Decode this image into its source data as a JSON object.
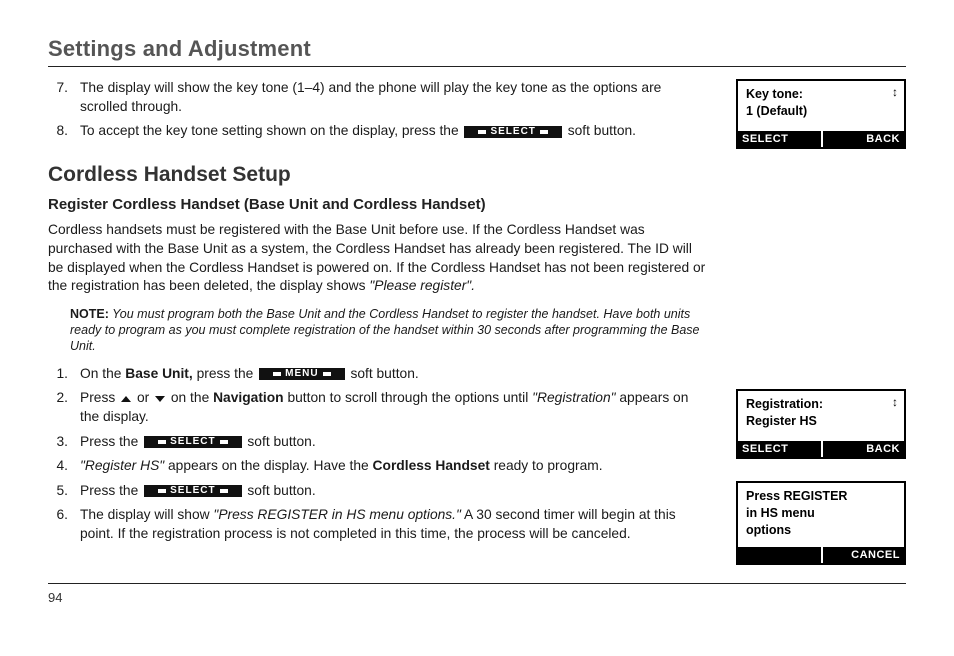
{
  "section_title": "Settings and Adjustment",
  "steps_top": [
    {
      "n": "7.",
      "pre": "The display will show the key tone (1–4) and the phone will play the key tone as the options are scrolled through."
    },
    {
      "n": "8.",
      "pre": "To accept the key tone setting shown on the display, press the ",
      "btn": "SELECT",
      "post": " soft button."
    }
  ],
  "cordless": {
    "title": "Cordless Handset Setup",
    "subtitle": "Register Cordless Handset (Base Unit and Cordless Handset)",
    "intro_a": "Cordless handsets must be registered with the Base Unit before use. If the Cordless Handset was purchased with the Base Unit as a system, the Cordless Handset has already been registered. The ID will be displayed when the Cordless Handset is powered on. If the Cordless Handset has not been registered or the registration has been deleted, the display shows ",
    "intro_quote": "\"Please register\".",
    "note_label": "NOTE:",
    "note_body": " You must program both the Base Unit and the Cordless Handset to register the handset. Have both units ready to program as you must complete registration of the handset within 30 seconds after programming the Base Unit.",
    "steps": [
      {
        "n": "1.",
        "pre": "On the ",
        "bold1": "Base Unit,",
        "mid": " press the ",
        "btn": "MENU",
        "post": " soft button."
      },
      {
        "n": "2.",
        "line2": true
      },
      {
        "n": "3.",
        "pre": "Press the ",
        "btn": "SELECT",
        "post": " soft button."
      },
      {
        "n": "4.",
        "quote": "\"Register HS\"",
        "mid": " appears on the display. Have the ",
        "bold1": "Cordless Handset",
        "post": " ready to program."
      },
      {
        "n": "5.",
        "pre": "Press the ",
        "btn": "SELECT",
        "post": " soft button."
      },
      {
        "n": "6.",
        "pre": "The display will show ",
        "quote": "\"Press REGISTER in HS menu options.\"",
        "post": " A 30 second timer will begin at this point. If the registration process is not completed in this time, the process will be canceled."
      }
    ],
    "step2": {
      "pre": "Press ",
      "mid": " or ",
      "mid2": " on the ",
      "bold": "Navigation",
      "mid3": " button to scroll through the options until ",
      "quote": "\"Registration\"",
      "post": " appears on the display."
    }
  },
  "lcd1": {
    "line1": "Key tone:",
    "line2": "1 (Default)",
    "sk_left": "SELECT",
    "sk_right": "BACK"
  },
  "lcd2": {
    "line1": "Registration:",
    "line2": "Register HS",
    "sk_left": "SELECT",
    "sk_right": "BACK"
  },
  "lcd3": {
    "line1": "Press REGISTER",
    "line2": "in HS menu",
    "line3": "options",
    "sk_right": "CANCEL"
  },
  "scroll_glyph": "↕",
  "page_number": "94"
}
